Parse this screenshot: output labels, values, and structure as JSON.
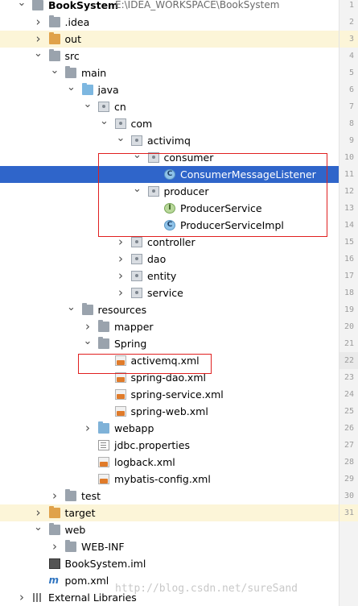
{
  "project": {
    "name": "BookSystem",
    "path": "E:\\IDEA_WORKSPACE\\BookSystem"
  },
  "tree": [
    {
      "label": "BookSystem",
      "path": "E:\\IDEA_WORKSPACE\\BookSystem",
      "icon": "project-folder-icon",
      "depth": 0,
      "arrow": "expanded",
      "bold": true
    },
    {
      "label": ".idea",
      "icon": "folder-icon",
      "depth": 1,
      "arrow": "collapsed"
    },
    {
      "label": "out",
      "icon": "excluded-folder-icon",
      "depth": 1,
      "arrow": "collapsed",
      "excluded": true
    },
    {
      "label": "src",
      "icon": "folder-icon",
      "depth": 1,
      "arrow": "expanded"
    },
    {
      "label": "main",
      "icon": "folder-icon",
      "depth": 2,
      "arrow": "expanded"
    },
    {
      "label": "java",
      "icon": "source-folder-icon",
      "depth": 3,
      "arrow": "expanded"
    },
    {
      "label": "cn",
      "icon": "package-icon",
      "depth": 4,
      "arrow": "expanded"
    },
    {
      "label": "com",
      "icon": "package-icon",
      "depth": 5,
      "arrow": "expanded"
    },
    {
      "label": "activimq",
      "icon": "package-icon",
      "depth": 6,
      "arrow": "expanded"
    },
    {
      "label": "consumer",
      "icon": "package-icon",
      "depth": 7,
      "arrow": "expanded"
    },
    {
      "label": "ConsumerMessageListener",
      "icon": "class-icon",
      "depth": 8,
      "arrow": "none",
      "selected": true
    },
    {
      "label": "producer",
      "icon": "package-icon",
      "depth": 7,
      "arrow": "expanded"
    },
    {
      "label": "ProducerService",
      "icon": "interface-icon",
      "depth": 8,
      "arrow": "none"
    },
    {
      "label": "ProducerServiceImpl",
      "icon": "class-icon",
      "depth": 8,
      "arrow": "none"
    },
    {
      "label": "controller",
      "icon": "package-icon",
      "depth": 6,
      "arrow": "collapsed"
    },
    {
      "label": "dao",
      "icon": "package-icon",
      "depth": 6,
      "arrow": "collapsed"
    },
    {
      "label": "entity",
      "icon": "package-icon",
      "depth": 6,
      "arrow": "collapsed"
    },
    {
      "label": "service",
      "icon": "package-icon",
      "depth": 6,
      "arrow": "collapsed"
    },
    {
      "label": "resources",
      "icon": "resources-folder-icon",
      "depth": 3,
      "arrow": "expanded"
    },
    {
      "label": "mapper",
      "icon": "folder-icon",
      "depth": 4,
      "arrow": "collapsed"
    },
    {
      "label": "Spring",
      "icon": "folder-icon",
      "depth": 4,
      "arrow": "expanded"
    },
    {
      "label": "activemq.xml",
      "icon": "xml-file-icon",
      "depth": 5,
      "arrow": "none"
    },
    {
      "label": "spring-dao.xml",
      "icon": "xml-file-icon",
      "depth": 5,
      "arrow": "none"
    },
    {
      "label": "spring-service.xml",
      "icon": "xml-file-icon",
      "depth": 5,
      "arrow": "none"
    },
    {
      "label": "spring-web.xml",
      "icon": "xml-file-icon",
      "depth": 5,
      "arrow": "none"
    },
    {
      "label": "webapp",
      "icon": "web-folder-icon",
      "depth": 4,
      "arrow": "collapsed"
    },
    {
      "label": "jdbc.properties",
      "icon": "properties-file-icon",
      "depth": 4,
      "arrow": "none"
    },
    {
      "label": "logback.xml",
      "icon": "xml-file-icon",
      "depth": 4,
      "arrow": "none"
    },
    {
      "label": "mybatis-config.xml",
      "icon": "xml-file-icon",
      "depth": 4,
      "arrow": "none"
    },
    {
      "label": "test",
      "icon": "folder-icon",
      "depth": 2,
      "arrow": "collapsed"
    },
    {
      "label": "target",
      "icon": "excluded-folder-icon",
      "depth": 1,
      "arrow": "collapsed",
      "excluded": true
    },
    {
      "label": "web",
      "icon": "folder-icon",
      "depth": 1,
      "arrow": "expanded"
    },
    {
      "label": "WEB-INF",
      "icon": "folder-icon",
      "depth": 2,
      "arrow": "collapsed"
    },
    {
      "label": "BookSystem.iml",
      "icon": "iml-file-icon",
      "depth": 1,
      "arrow": "none"
    },
    {
      "label": "pom.xml",
      "icon": "maven-pom-icon",
      "depth": 1,
      "arrow": "none"
    },
    {
      "label": "External Libraries",
      "icon": "libraries-icon",
      "depth": 0,
      "arrow": "collapsed"
    }
  ],
  "gutter": {
    "line_numbers": [
      "1",
      "2",
      "3",
      "4",
      "5",
      "6",
      "7",
      "8",
      "9",
      "10",
      "11",
      "12",
      "13",
      "14",
      "15",
      "16",
      "17",
      "18",
      "19",
      "20",
      "21",
      "22",
      "23",
      "24",
      "25",
      "26",
      "27",
      "28",
      "29",
      "30",
      "31"
    ],
    "current_line": "22"
  },
  "watermark": "http://blog.csdn.net/sureSand",
  "colors": {
    "selection": "#2f65ca",
    "excluded_row": "#fcf5d8",
    "annotation_box": "#e02020"
  }
}
